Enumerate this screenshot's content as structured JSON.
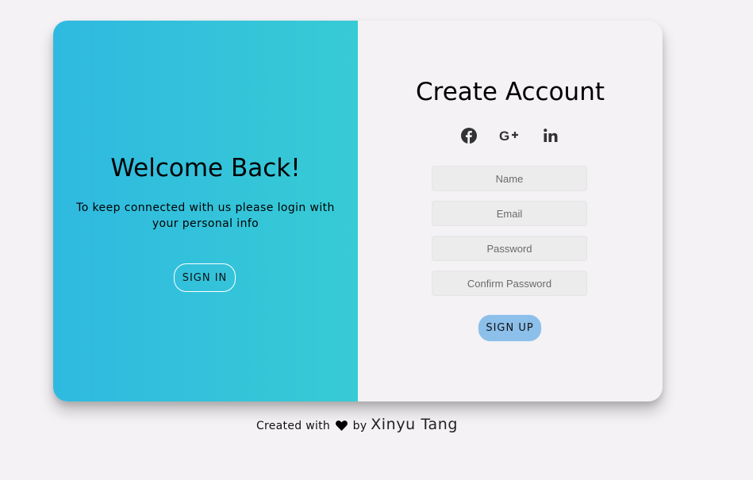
{
  "welcome_panel": {
    "title": "Welcome Back!",
    "message": "To keep connected with us please login with your personal info",
    "signin_label": "SIGN IN",
    "gradient_start": "#2fb9e0",
    "gradient_end": "#37cbd5"
  },
  "signup_panel": {
    "title": "Create Account",
    "social_icons": [
      "facebook-icon",
      "google-plus-icon",
      "linkedin-icon"
    ],
    "fields": {
      "name_placeholder": "Name",
      "email_placeholder": "Email",
      "password_placeholder": "Password",
      "confirm_password_placeholder": "Confirm Password"
    },
    "signup_label": "SIGN UP",
    "signup_color": "#8cbfea"
  },
  "footer": {
    "prefix": "Created with",
    "icon": "heart-icon",
    "by": "by",
    "author": "Xinyu Tang"
  }
}
